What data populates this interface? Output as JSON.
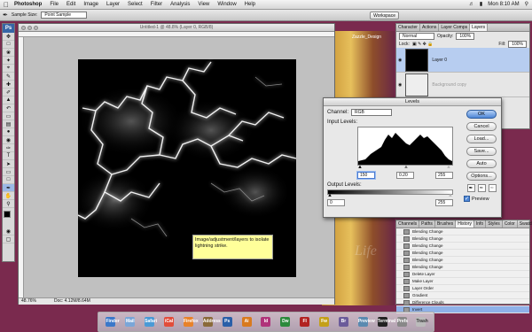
{
  "menubar": {
    "app": "Photoshop",
    "items": [
      "File",
      "Edit",
      "Image",
      "Layer",
      "Select",
      "Filter",
      "Analysis",
      "View",
      "Window",
      "Help"
    ],
    "clock": "Mon 8:10 AM"
  },
  "options": {
    "sample_size_label": "Sample Size:",
    "sample_size_value": "Point Sample",
    "workspace": "Workspace"
  },
  "document": {
    "title": "Untitled-1 @ 48.8% (Layer 0, RGB/8)",
    "zoom": "48.76%",
    "doc_info": "Doc: 4.12M/8.64M"
  },
  "note": {
    "text": "Image/adjustment/layers to isolate lightning strike."
  },
  "layers_panel": {
    "tabs": [
      "Character",
      "Actions",
      "Layer Comps",
      "Layers"
    ],
    "blend_mode": "Normal",
    "opacity_label": "Opacity:",
    "opacity": "100%",
    "lock_label": "Lock:",
    "fill_label": "Fill:",
    "fill": "100%",
    "layers": [
      {
        "name": "Layer 0",
        "selected": true
      },
      {
        "name": "Background copy",
        "selected": false
      }
    ]
  },
  "desktop": {
    "folder_label": "Zazzle_Design"
  },
  "levels": {
    "title": "Levels",
    "channel_label": "Channel:",
    "channel": "RGB",
    "input_label": "Input Levels:",
    "input_black": "150",
    "input_gamma": "0.20",
    "input_white": "255",
    "output_label": "Output Levels:",
    "output_black": "0",
    "output_white": "255",
    "buttons": {
      "ok": "OK",
      "cancel": "Cancel",
      "load": "Load...",
      "save": "Save...",
      "auto": "Auto",
      "options": "Options..."
    },
    "preview_label": "Preview",
    "preview_checked": true
  },
  "history_panel": {
    "tabs": [
      "Channels",
      "Paths",
      "Brushes",
      "History",
      "Info",
      "Styles",
      "Color",
      "Swatches"
    ],
    "items": [
      "Blending Change",
      "Blending Change",
      "Blending Change",
      "Blending Change",
      "Blending Change",
      "Blending Change",
      "Delete Layer",
      "Make Layer",
      "Layer Order",
      "Gradient",
      "Difference Clouds",
      "Invert"
    ],
    "active_index": 11
  },
  "dock": {
    "apps": [
      "Finder",
      "Mail",
      "Safari",
      "iCal",
      "Firefox",
      "Address",
      "Ps",
      "Ai",
      "Id",
      "Dw",
      "Fl",
      "Fw",
      "Br",
      "Preview",
      "Terminal",
      "Prefs",
      "Trash"
    ]
  }
}
